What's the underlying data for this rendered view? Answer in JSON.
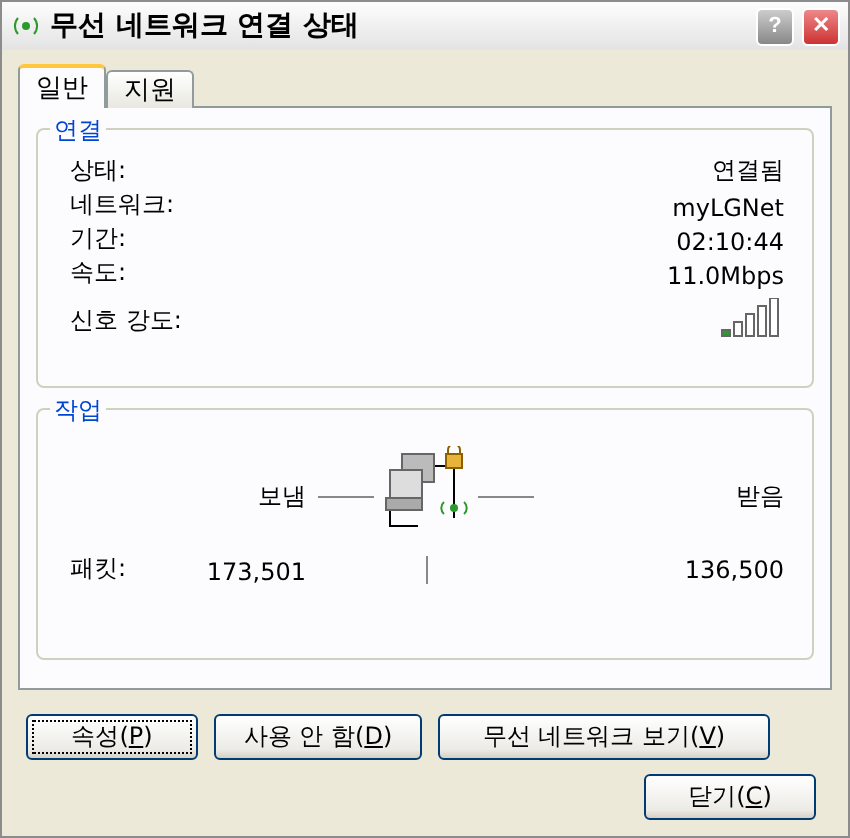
{
  "window": {
    "title": "무선 네트워크 연결 상태",
    "help": "?",
    "close": "✕"
  },
  "tabs": [
    {
      "label": "일반",
      "selected": true
    },
    {
      "label": "지원",
      "selected": false
    }
  ],
  "connection": {
    "title": "연결",
    "rows": [
      {
        "kind": "text",
        "label": "상태:",
        "value": "연결됨"
      },
      {
        "kind": "text",
        "label": "네트워크:",
        "value": "myLGNet"
      },
      {
        "kind": "text",
        "label": "기간:",
        "value": "02:10:44"
      },
      {
        "kind": "text",
        "label": "속도:",
        "value": "11.0Mbps"
      },
      {
        "kind": "signal",
        "label": "신호 강도:"
      }
    ]
  },
  "activity": {
    "title": "작업",
    "sent": "보냄",
    "received": "받음",
    "packets_label": "패킷:",
    "packets_sent": "173,501",
    "packets_received": "136,500"
  },
  "buttons": [
    {
      "before": "속성(",
      "mnemonic": "P",
      "after": ")",
      "focused": true
    },
    {
      "before": "사용 안 함(",
      "mnemonic": "D",
      "after": ")",
      "focused": false
    },
    {
      "before": "무선 네트워크 보기(",
      "mnemonic": "V",
      "after": ")",
      "focused": false
    }
  ],
  "close_button": {
    "before": "닫기(",
    "mnemonic": "C",
    "after": ")"
  }
}
